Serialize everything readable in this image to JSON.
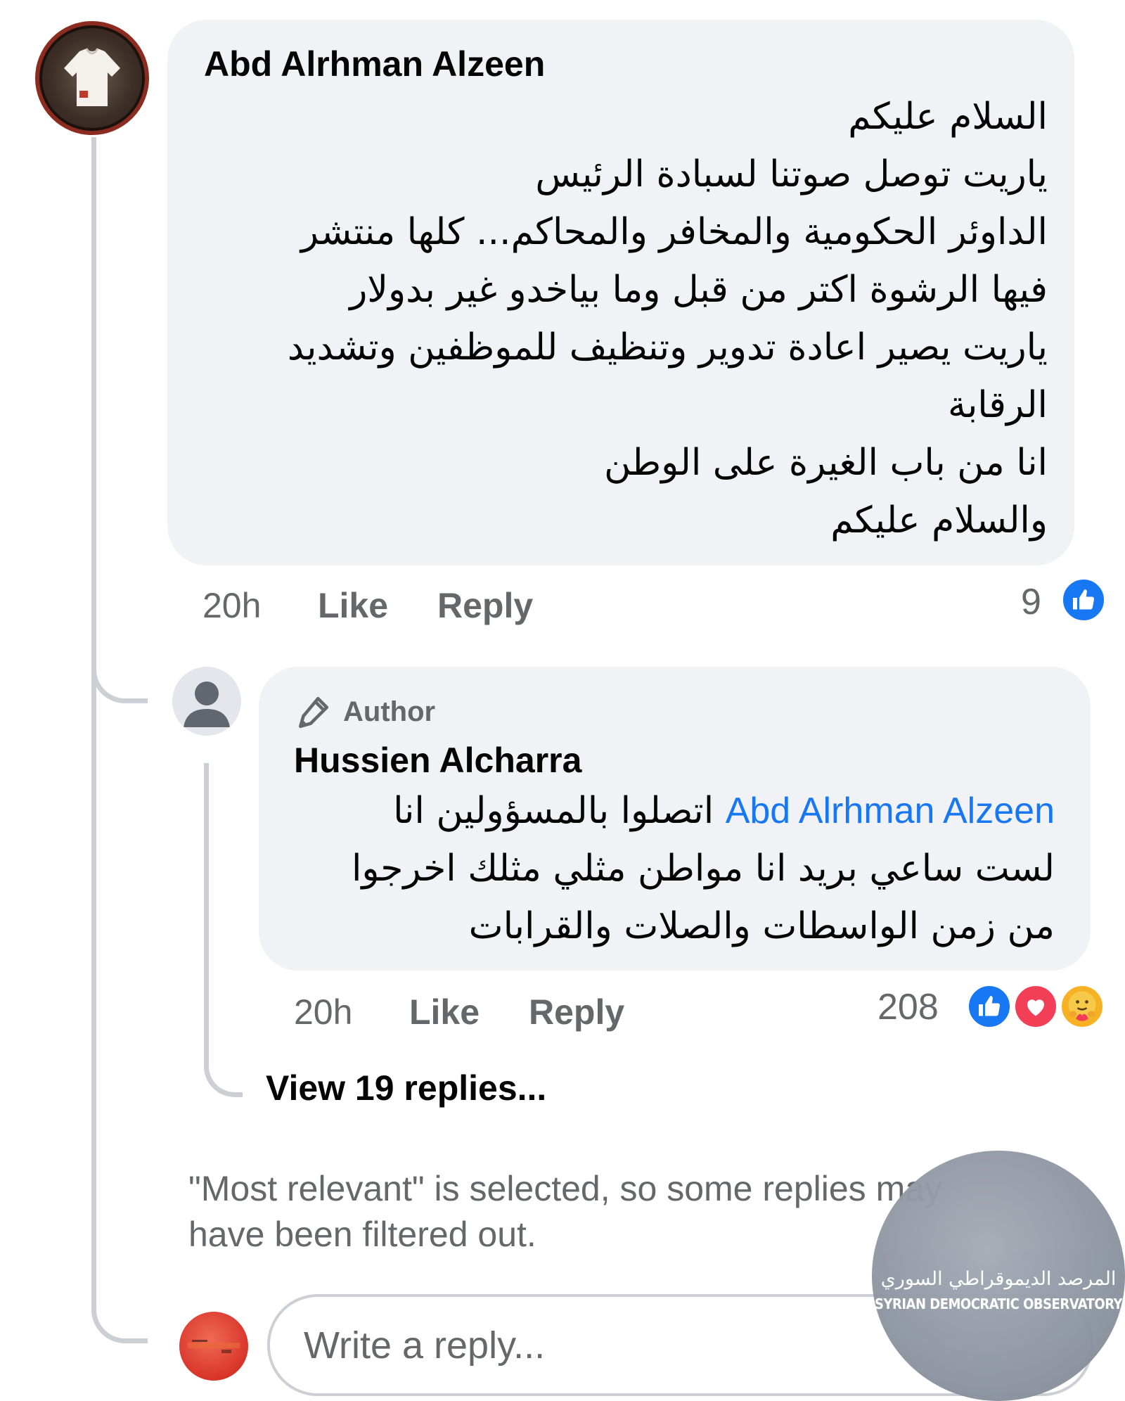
{
  "comment": {
    "author_name": "Abd Alrhman Alzeen",
    "lines": [
      "السلام عليكم",
      "ياريت توصل صوتنا لسبادة الرئيس",
      "الداوئر الحكومية والمخافر والمحاكم... كلها منتشر",
      "فيها الرشوة اكتر من قبل وما بياخدو غير بدولار",
      "ياريت يصير اعادة تدوير وتنظيف للموظفين وتشديد",
      "الرقابة",
      "انا من باب الغيرة على الوطن",
      "والسلام عليكم"
    ],
    "time": "20h",
    "like_label": "Like",
    "reply_label": "Reply",
    "reaction_count": "9"
  },
  "reply": {
    "badge_label": "Author",
    "author_name": "Hussien Alcharra",
    "mention": "Abd Alrhman Alzeen",
    "line1_rest": "اتصلوا بالمسؤولين انا",
    "line2": "لست ساعي بريد  انا مواطن مثلي مثلك اخرجوا",
    "line3": "من زمن الواسطات والصلات والقرابات",
    "time": "20h",
    "like_label": "Like",
    "reply_label": "Reply",
    "reaction_count": "208"
  },
  "view_replies_label": "View 19 replies...",
  "filter_notice_line1": "\"Most relevant\" is selected, so some replies may",
  "filter_notice_line2": "have been filtered out.",
  "reply_input": {
    "placeholder": "Write a reply..."
  },
  "watermark": {
    "arabic": "المرصد الديموقراطي السوري",
    "english": "SYRIAN DEMOCRATIC OBSERVATORY"
  },
  "colors": {
    "bubble": "#f0f2f5",
    "link": "#1877f2",
    "like": "#1877f2",
    "love": "#f33e58",
    "care": "#f7b125",
    "secondary_text": "#65676b",
    "thread_line": "#ccd0d5"
  },
  "icons": {
    "like_reaction": "thumbs-up-icon",
    "love_reaction": "heart-icon",
    "care_reaction": "care-emoji-icon",
    "author_badge": "pen-icon"
  }
}
